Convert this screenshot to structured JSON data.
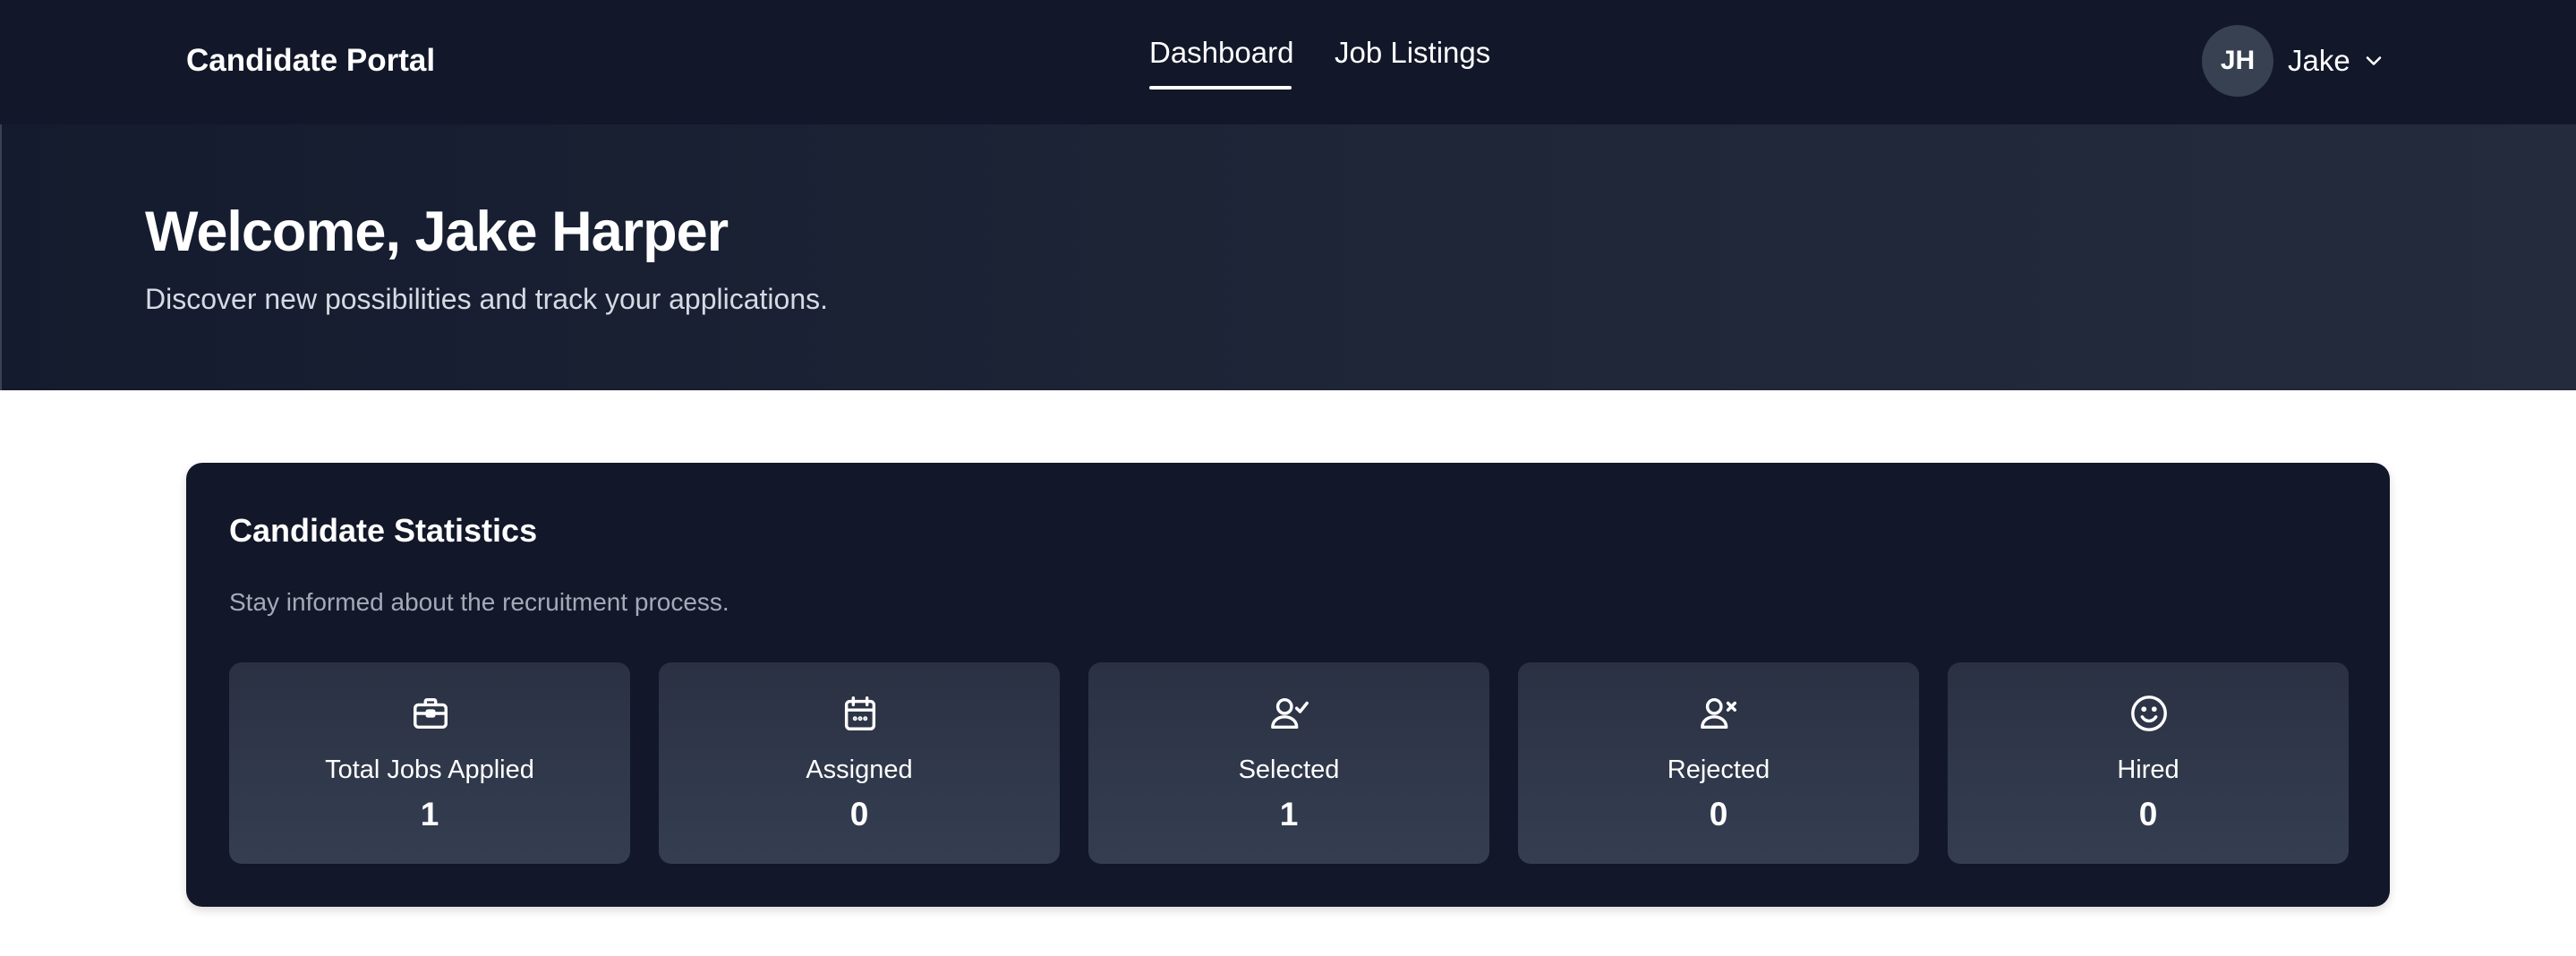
{
  "header": {
    "brand": "Candidate Portal",
    "nav": [
      {
        "label": "Dashboard",
        "active": true
      },
      {
        "label": "Job Listings",
        "active": false
      }
    ],
    "user": {
      "initials": "JH",
      "name": "Jake",
      "menu_icon": "chevron-down-icon"
    }
  },
  "hero": {
    "title": "Welcome, Jake Harper",
    "subtitle": "Discover new possibilities and track your applications."
  },
  "stats": {
    "title": "Candidate Statistics",
    "subtitle": "Stay informed about the recruitment process.",
    "items": [
      {
        "label": "Total Jobs Applied",
        "value": "1",
        "icon": "briefcase-icon"
      },
      {
        "label": "Assigned",
        "value": "0",
        "icon": "calendar-icon"
      },
      {
        "label": "Selected",
        "value": "1",
        "icon": "user-check-icon"
      },
      {
        "label": "Rejected",
        "value": "0",
        "icon": "user-x-icon"
      },
      {
        "label": "Hired",
        "value": "0",
        "icon": "smile-icon"
      }
    ]
  },
  "colors": {
    "navbar_bg": "#121829",
    "card_bg": "#121829",
    "tile_bg": "#2f374a",
    "text_primary": "#ffffff",
    "text_muted": "#a4aab7"
  }
}
